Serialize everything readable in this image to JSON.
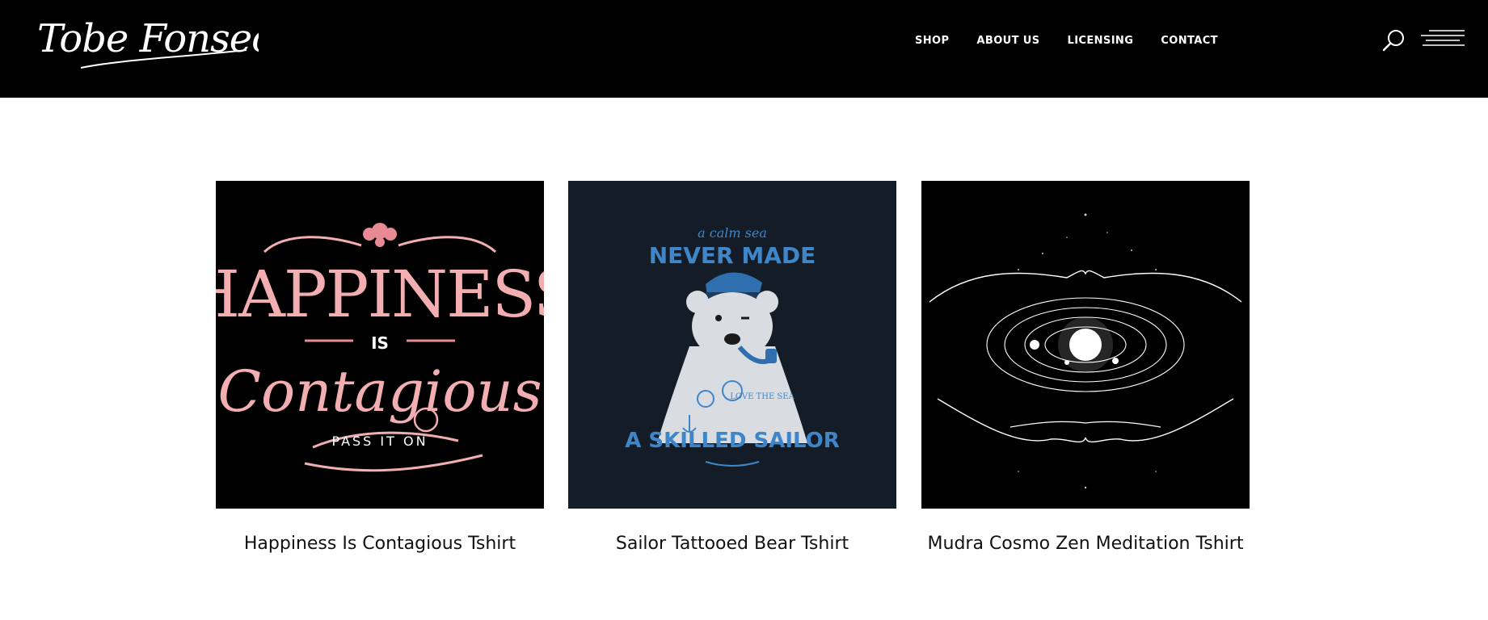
{
  "header": {
    "logo_text": "Tobe Fonseca",
    "background": "#000000"
  },
  "nav": {
    "items": [
      {
        "label": "SHOP"
      },
      {
        "label": "ABOUT US"
      },
      {
        "label": "LICENSING"
      },
      {
        "label": "CONTACT"
      }
    ],
    "search_icon": "search-icon",
    "menu_icon": "hamburger-menu-icon"
  },
  "products": [
    {
      "title": "Happiness Is Contagious Tshirt",
      "art": {
        "background": "#000000",
        "accent": "#f2aeb0",
        "word1": "HAPPINESS",
        "word2": "IS",
        "word3": "Contagious",
        "tagline": "PASS IT ON"
      }
    },
    {
      "title": "Sailor Tattooed Bear Tshirt",
      "art": {
        "background": "#141d27",
        "accent": "#3f86c9",
        "line1": "a calm sea",
        "line2": "NEVER MADE",
        "line3": "A SKILLED SAILOR",
        "tattoo": "LOVE THE SEA"
      }
    },
    {
      "title": "Mudra Cosmo Zen Meditation Tshirt",
      "art": {
        "background": "#000000",
        "accent": "#ffffff"
      }
    }
  ]
}
